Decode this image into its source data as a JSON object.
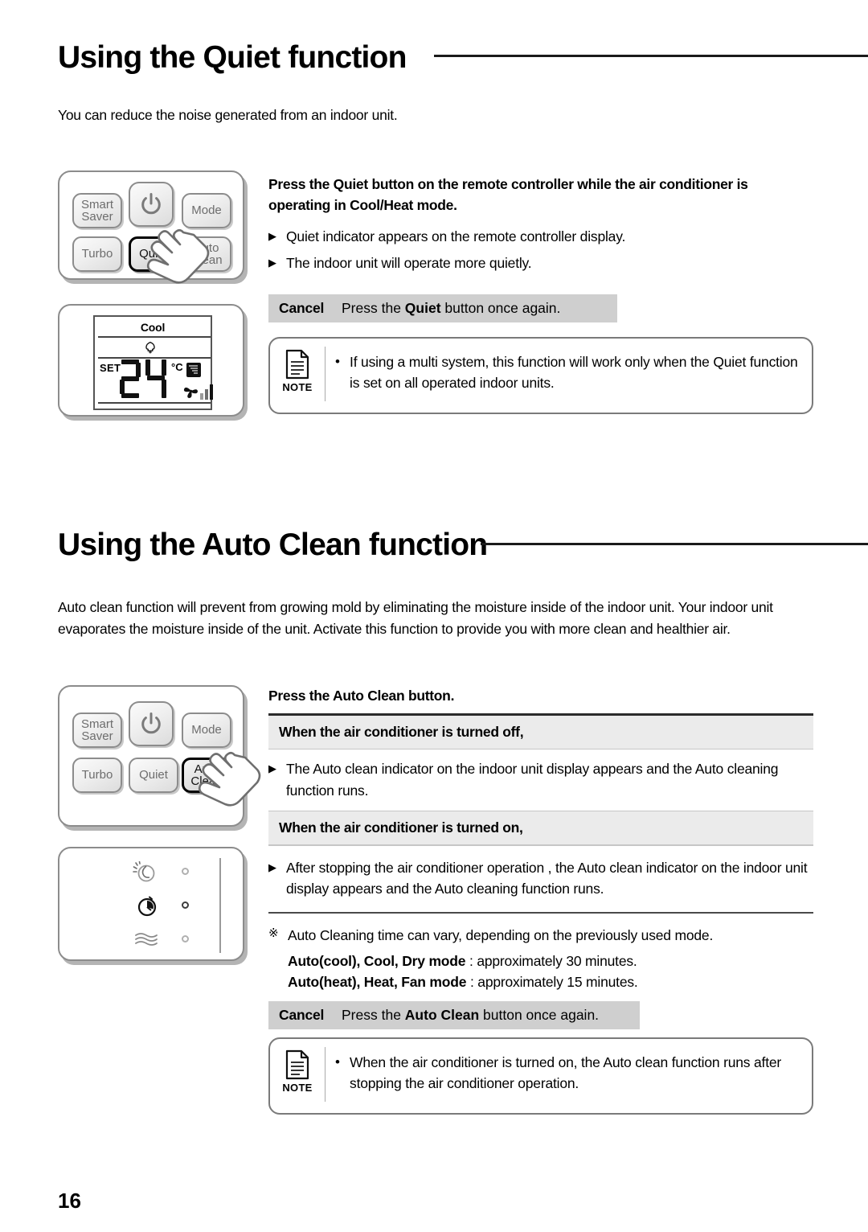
{
  "page": {
    "number": "16"
  },
  "sections": [
    {
      "id": "quiet",
      "title": "Using the Quiet function",
      "intro": "You can reduce the noise generated from an indoor unit.",
      "instruction_title_1": "Press the ",
      "instruction_title_bold": "Quiet",
      "instruction_title_2": " button on the remote controller while the air conditioner is operating in Cool/Heat mode.",
      "bullets": [
        "Quiet indicator appears on the remote controller display.",
        "The indoor unit will operate more quietly."
      ],
      "cancel_label": "Cancel",
      "cancel_pre": "Press the ",
      "cancel_bold": "Quiet",
      "cancel_post": " button once again.",
      "note_label": "NOTE",
      "note_text": "If using a multi system, this function will work only when the Quiet function is set on all operated indoor units."
    },
    {
      "id": "autoclean",
      "title": "Using the Auto Clean function",
      "intro": "Auto clean function will prevent from growing mold by eliminating the moisture inside of the indoor unit. Your indoor unit evaporates the moisture inside of the unit. Activate this function to provide you with more clean and healthier air.",
      "instruction_title_1": "Press the ",
      "instruction_title_bold": "Auto Clean",
      "instruction_title_2": " button.",
      "band_off": "When the air conditioner is turned off,",
      "bullet_off": "The Auto clean indicator on the indoor unit display appears and the Auto cleaning function runs.",
      "band_on": "When the air conditioner is turned on,",
      "bullet_on": "After stopping the air conditioner operation , the Auto clean indicator on the indoor unit display appears and the Auto cleaning function runs.",
      "star_mark": "※",
      "star_text": "Auto Cleaning time can vary, depending on the previously used mode.",
      "timing_1_bold": "Auto(cool), Cool, Dry mode",
      "timing_1_rest": " : approximately 30 minutes.",
      "timing_2_bold": "Auto(heat), Heat, Fan mode",
      "timing_2_rest": " : approximately 15 minutes.",
      "cancel_label": "Cancel",
      "cancel_pre": "Press the ",
      "cancel_bold": "Auto Clean",
      "cancel_post": " button once again.",
      "note_label": "NOTE",
      "note_text": "When the air conditioner is turned on, the Auto clean function runs after stopping the air conditioner operation."
    }
  ],
  "remote": {
    "buttons": {
      "smart_saver_line1": "Smart",
      "smart_saver_line2": "Saver",
      "power": "power-icon",
      "mode": "Mode",
      "turbo": "Turbo",
      "quiet": "Quiet",
      "auto_clean_line1": "Auto",
      "auto_clean_line2": "Clean"
    }
  },
  "lcd": {
    "mode": "Cool",
    "set_label": "SET",
    "temperature": "24",
    "unit": "°C",
    "icons": [
      "quiet-indicator-icon",
      "airflow-icon",
      "fan-icon",
      "fan-speed-bars"
    ]
  },
  "indoor_display": {
    "indicators": [
      "auto-clean-icon",
      "timer-icon",
      "airflow-wave-icon"
    ],
    "led_count": 3
  },
  "colors": {
    "band_gray": "#ebebeb",
    "cancel_gray": "#cfcfcf",
    "rule_dark": "#2b2b2b",
    "outline_gray": "#8c8c8c"
  }
}
